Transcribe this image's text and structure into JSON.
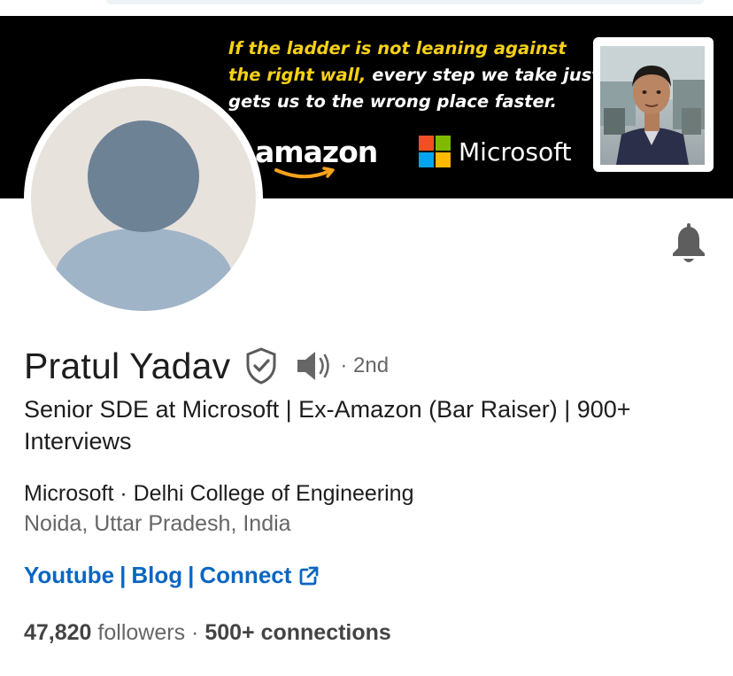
{
  "banner": {
    "quote_lines": [
      {
        "segments": [
          {
            "text": "If the ladder is not leaning against",
            "color": "yellow"
          }
        ]
      },
      {
        "segments": [
          {
            "text": "the right wall,",
            "color": "yellow"
          },
          {
            "text": " every step we take just",
            "color": "white"
          }
        ]
      },
      {
        "segments": [
          {
            "text": "gets us to the wrong place faster.",
            "color": "white"
          }
        ]
      }
    ],
    "amazon_logo_text": "amazon",
    "microsoft_logo_text": "Microsoft",
    "microsoft_colors": [
      "#f25022",
      "#7fba00",
      "#00a4ef",
      "#ffb900"
    ]
  },
  "profile": {
    "name": "Pratul Yadav",
    "degree": "· 2nd",
    "headline": "Senior SDE at Microsoft | Ex-Amazon (Bar Raiser) | 900+ Interviews",
    "company_school": "Microsoft · Delhi College of Engineering",
    "location": "Noida, Uttar Pradesh, India",
    "links": {
      "youtube": "Youtube",
      "sep1": "|",
      "blog": "Blog",
      "sep2": "|",
      "connect": "Connect"
    },
    "followers_count": "47,820",
    "followers_label": "followers",
    "stats_sep": "·",
    "connections": "500+ connections"
  },
  "icons": {
    "bell": "bell-icon",
    "verified": "verified-shield-icon",
    "pronunciation": "speaker-icon",
    "external_link": "external-link-icon"
  },
  "colors": {
    "link_blue": "#0a66c2",
    "banner_yellow": "#f7d117",
    "avatar_body": "#a0b4c8",
    "avatar_head": "#6e8296"
  }
}
